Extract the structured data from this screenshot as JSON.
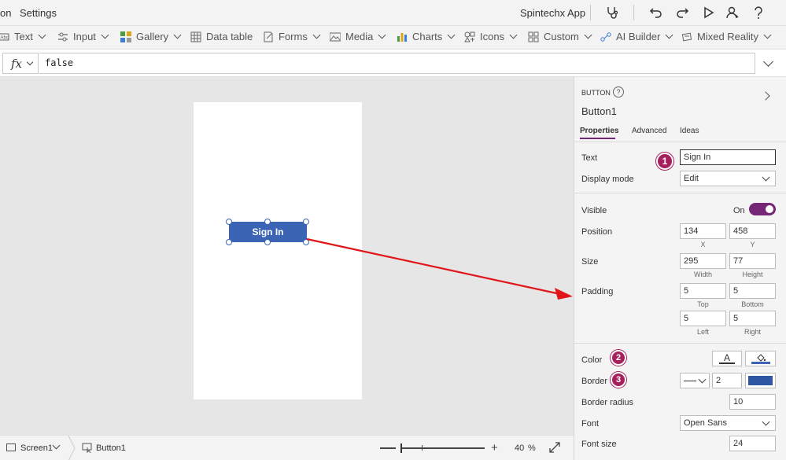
{
  "topbar": {
    "menu_partial": "on",
    "settings": "Settings",
    "app_name": "Spintechx App"
  },
  "ribbon": {
    "items": [
      {
        "label": "Text",
        "icon": "text-icon"
      },
      {
        "label": "Input",
        "icon": "input-icon"
      },
      {
        "label": "Gallery",
        "icon": "gallery-icon"
      },
      {
        "label": "Data table",
        "icon": "table-icon"
      },
      {
        "label": "Forms",
        "icon": "forms-icon"
      },
      {
        "label": "Media",
        "icon": "media-icon"
      },
      {
        "label": "Charts",
        "icon": "charts-icon"
      },
      {
        "label": "Icons",
        "icon": "icons-icon"
      },
      {
        "label": "Custom",
        "icon": "custom-icon"
      },
      {
        "label": "AI Builder",
        "icon": "ai-builder-icon"
      },
      {
        "label": "Mixed Reality",
        "icon": "mixed-reality-icon"
      }
    ]
  },
  "formula": {
    "fx_label": "fx",
    "value": "false"
  },
  "canvas": {
    "button_label": "Sign In"
  },
  "panel": {
    "type_label": "BUTTON",
    "control_name": "Button1",
    "tabs": [
      "Properties",
      "Advanced",
      "Ideas"
    ],
    "text_label": "Text",
    "text_value": "Sign In",
    "display_mode_label": "Display mode",
    "display_mode_value": "Edit",
    "visible_label": "Visible",
    "visible_state": "On",
    "position_label": "Position",
    "position_x": "134",
    "position_y": "458",
    "x_label": "X",
    "y_label": "Y",
    "size_label": "Size",
    "width_value": "295",
    "height_value": "77",
    "width_label": "Width",
    "height_label": "Height",
    "padding_label": "Padding",
    "padding_top": "5",
    "padding_bottom": "5",
    "padding_left": "5",
    "padding_right": "5",
    "top_label": "Top",
    "bottom_label": "Bottom",
    "left_label": "Left",
    "right_label": "Right",
    "color_label": "Color",
    "color_text_glyph": "A",
    "border_label": "Border",
    "border_width": "2",
    "border_radius_label": "Border radius",
    "border_radius_value": "10",
    "font_label": "Font",
    "font_value": "Open Sans",
    "font_size_label": "Font size",
    "font_size_value": "24",
    "accent_color": "#742774",
    "button_fill": "#3b64b5"
  },
  "annotations": {
    "badges": [
      "1",
      "2",
      "3"
    ],
    "badge_color": "#a6205e",
    "arrow_color": "#e0161b"
  },
  "status": {
    "screen_label": "Screen1",
    "control_label": "Button1",
    "zoom_value": "40",
    "zoom_unit": "%"
  }
}
